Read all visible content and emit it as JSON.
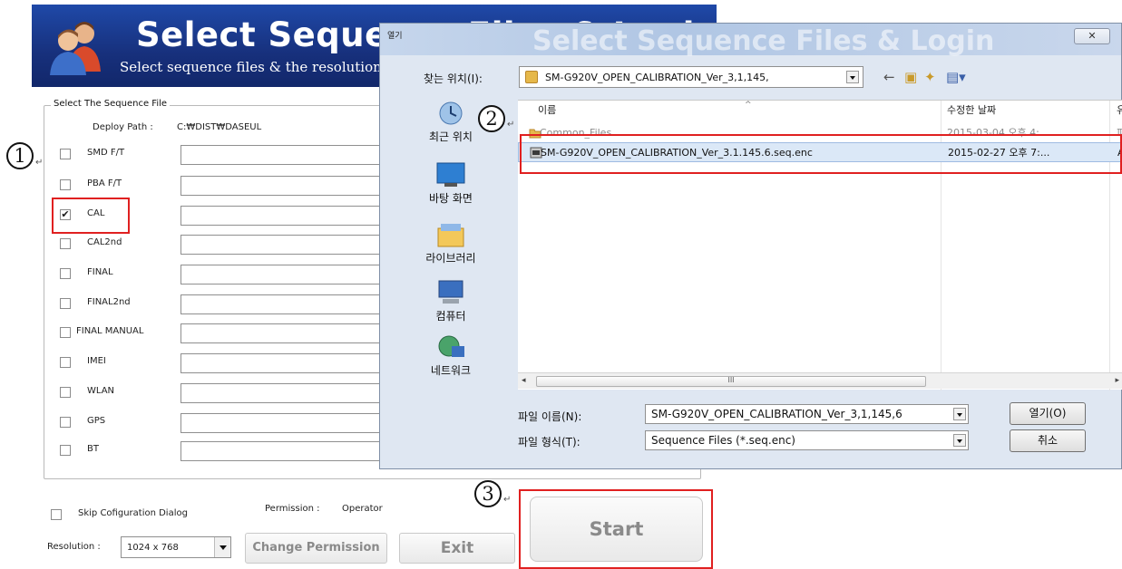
{
  "app": {
    "title": "Select Sequence Files & Login",
    "subtitle": "Select sequence files & the resolution",
    "group_title": "Select The Sequence File",
    "deploy_label": "Deploy Path :",
    "deploy_value": "C:₩DIST₩DASEUL",
    "sequences": [
      {
        "label": "SMD F/T",
        "checked": false
      },
      {
        "label": "PBA F/T",
        "checked": false
      },
      {
        "label": "CAL",
        "checked": true
      },
      {
        "label": "CAL2nd",
        "checked": false
      },
      {
        "label": "FINAL",
        "checked": false
      },
      {
        "label": "FINAL2nd",
        "checked": false
      },
      {
        "label": "FINAL MANUAL",
        "checked": false
      },
      {
        "label": "IMEI",
        "checked": false
      },
      {
        "label": "WLAN",
        "checked": false
      },
      {
        "label": "GPS",
        "checked": false
      },
      {
        "label": "BT",
        "checked": false
      }
    ],
    "skip_config_label": "Skip Cofiguration Dialog",
    "permission_label": "Permission :",
    "permission_value": "Operator",
    "resolution_label": "Resolution :",
    "resolution_value": "1024 x 768",
    "change_permission_label": "Change Permission",
    "exit_label": "Exit",
    "start_label": "Start"
  },
  "dialog": {
    "title": "열기",
    "lookin_label": "찾는 위치(I):",
    "lookin_value": "SM-G920V_OPEN_CALIBRATION_Ver_3,1,145,",
    "places": [
      "최근 위치",
      "바탕 화면",
      "라이브러리",
      "컴퓨터",
      "네트워크"
    ],
    "columns": {
      "name": "이름",
      "date": "수정한 날짜",
      "extra": "유"
    },
    "files": [
      {
        "name": "Common_Files",
        "date": "2015-03-04 오후 4:...",
        "extra": "파",
        "icon": "folder-icon",
        "selected": false
      },
      {
        "name": "SM-G920V_OPEN_CALIBRATION_Ver_3.1.145.6.seq.enc",
        "date": "2015-02-27 오후 7:...",
        "extra": "A",
        "icon": "file-enc-icon",
        "selected": true
      }
    ],
    "scroll_grip": "III",
    "filename_label": "파일 이름(N):",
    "filename_value": "SM-G920V_OPEN_CALIBRATION_Ver_3,1,145,6",
    "filetype_label": "파일 형식(T):",
    "filetype_value": "Sequence Files (*.seq.enc)",
    "open_label": "열기(O)",
    "cancel_label": "취소"
  },
  "steps": [
    "1",
    "2",
    "3"
  ],
  "colors": {
    "highlight": "#e02020",
    "header_blue": "#1f49a8",
    "selection": "#dbe8f7"
  }
}
